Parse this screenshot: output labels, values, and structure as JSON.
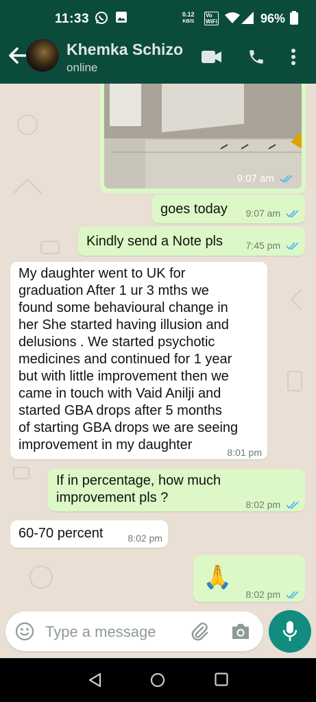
{
  "status_bar": {
    "time": "11:33",
    "net_speed_value": "0.12",
    "net_speed_unit": "KB/S",
    "vowifi_line1": "Vo",
    "vowifi_line2": "WiFi",
    "battery": "96%"
  },
  "header": {
    "contact_name": "Khemka Schizo",
    "status": "online",
    "icons": [
      "back-arrow-icon",
      "video-call-icon",
      "voice-call-icon",
      "more-vert-icon"
    ]
  },
  "messages": [
    {
      "direction": "outgoing",
      "type": "image",
      "time": "9:07 am",
      "read": true
    },
    {
      "direction": "outgoing",
      "text": "goes today",
      "time": "9:07 am",
      "read": true
    },
    {
      "direction": "outgoing",
      "text": "Kindly send a Note pls",
      "time": "7:45 pm",
      "read": true
    },
    {
      "direction": "incoming",
      "lines": [
        "My daughter went to UK for",
        "graduation After 1 ur 3 mths we",
        "found some behavioural change in",
        "her She started having illusion and",
        "delusions . We started psychotic",
        "medicines and continued for 1 year",
        "but with little improvement then we",
        "came in touch with Vaid Anilji and",
        "started GBA drops after 5 months",
        "of starting GBA drops we are seeing",
        "improvement in my daughter"
      ],
      "time": "8:01 pm"
    },
    {
      "direction": "outgoing",
      "lines": [
        "If in percentage, how much",
        "improvement pls ?"
      ],
      "time": "8:02 pm",
      "read": true
    },
    {
      "direction": "incoming",
      "text": "60-70 percent",
      "time": "8:02 pm"
    },
    {
      "direction": "outgoing",
      "text": "🙏",
      "time": "8:02 pm",
      "read": true
    }
  ],
  "input": {
    "placeholder": "Type a message",
    "icons": [
      "emoji-icon",
      "attach-icon",
      "camera-icon",
      "mic-icon"
    ]
  },
  "colors": {
    "header": "#0b4b3c",
    "outgoing_bubble": "#dcf8c6",
    "incoming_bubble": "#ffffff",
    "chat_background": "#e9dfd5",
    "read_ticks": "#4fb6ec",
    "mic_button": "#128c7e"
  }
}
